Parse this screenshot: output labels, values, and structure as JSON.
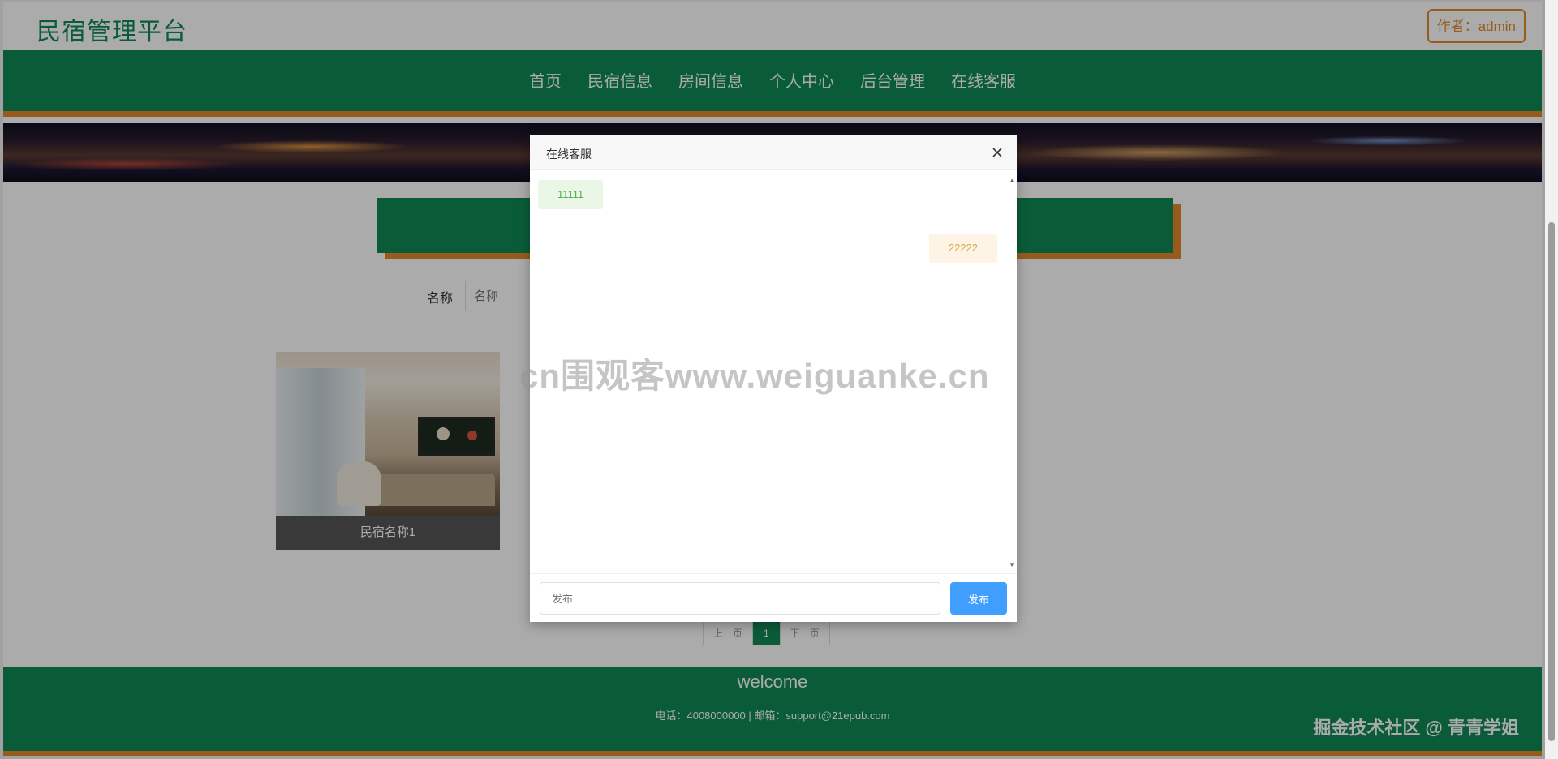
{
  "header": {
    "site_title": "民宿管理平台",
    "author_button": "作者：admin"
  },
  "nav": {
    "items": [
      "首页",
      "民宿信息",
      "房间信息",
      "个人中心",
      "后台管理",
      "在线客服"
    ]
  },
  "search": {
    "label": "名称",
    "placeholder": "名称"
  },
  "cards": [
    {
      "caption": "民宿名称1"
    }
  ],
  "pagination": {
    "prev": "上一页",
    "current": "1",
    "next": "下一页"
  },
  "footer": {
    "title": "welcome",
    "contact": "电话：4008000000 | 邮箱：support@21epub.com"
  },
  "watermarks": {
    "center": "cn围观客www.weiguanke.cn",
    "corner": "掘金技术社区 @ 青青学姐"
  },
  "dialog": {
    "title": "在线客服",
    "messages": [
      {
        "side": "left",
        "text": "11111"
      },
      {
        "side": "right",
        "text": "22222"
      }
    ],
    "input_placeholder": "发布",
    "send_button": "发布"
  },
  "colors": {
    "brand_green": "#0f8a55",
    "accent_orange": "#e28a2b",
    "send_blue": "#409eff"
  }
}
